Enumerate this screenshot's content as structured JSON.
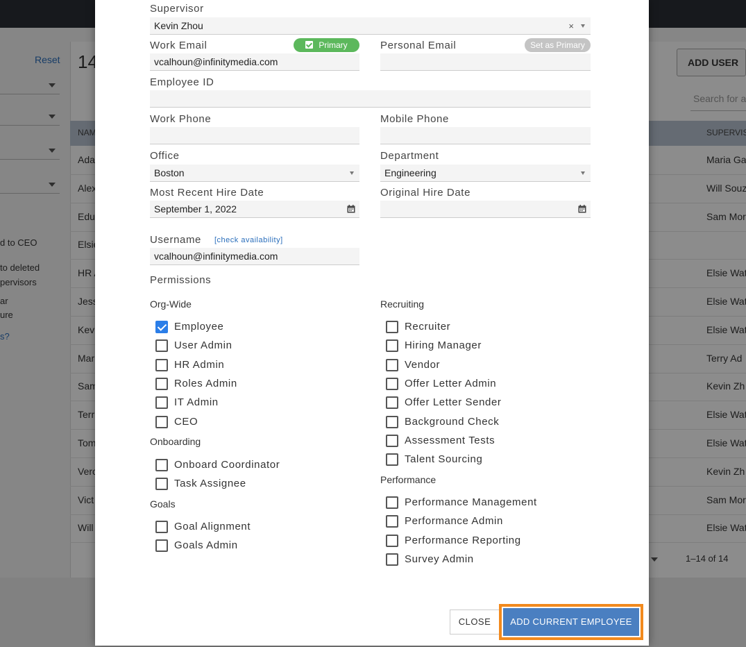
{
  "background": {
    "reset_label": "Reset",
    "count_title": "14",
    "add_user_label": "ADD USER",
    "search_placeholder": "Search for a",
    "header_name": "NAM",
    "header_supervisor": "SUPERVISO",
    "left_texts": [
      "d to CEO",
      "to deleted",
      "pervisors",
      "ar",
      "ure"
    ],
    "left_link": "s?",
    "rows": [
      {
        "name": "Ada",
        "supervisor": "Maria Ga"
      },
      {
        "name": "Alex",
        "supervisor": "Will Souz"
      },
      {
        "name": "Edu",
        "supervisor": "Sam Mor"
      },
      {
        "name": "Elsie",
        "supervisor": ""
      },
      {
        "name": "HR A",
        "supervisor": "Elsie Wat"
      },
      {
        "name": "Jess",
        "supervisor": "Elsie Wat"
      },
      {
        "name": "Kev",
        "supervisor": "Elsie Wat"
      },
      {
        "name": "Mar",
        "supervisor": "Terry Ad"
      },
      {
        "name": "Sam",
        "supervisor": "Kevin Zh"
      },
      {
        "name": "Terr",
        "supervisor": "Elsie Wat"
      },
      {
        "name": "Tom",
        "supervisor": "Elsie Wat"
      },
      {
        "name": "Vero",
        "supervisor": "Kevin Zh"
      },
      {
        "name": "Vict",
        "supervisor": "Sam Mor"
      },
      {
        "name": "Will",
        "supervisor": "Elsie Wat"
      }
    ],
    "pager_text": "1–14 of 14"
  },
  "form": {
    "supervisor_label": "Supervisor",
    "supervisor_value": "Kevin Zhou",
    "supervisor_clear": "×",
    "work_email_label": "Work Email",
    "work_email_badge": "Primary",
    "work_email_value": "vcalhoun@infinitymedia.com",
    "personal_email_label": "Personal Email",
    "personal_email_badge": "Set as Primary",
    "personal_email_value": "",
    "employee_id_label": "Employee ID",
    "employee_id_value": "",
    "work_phone_label": "Work Phone",
    "work_phone_value": "",
    "mobile_phone_label": "Mobile Phone",
    "mobile_phone_value": "",
    "office_label": "Office",
    "office_value": "Boston",
    "department_label": "Department",
    "department_value": "Engineering",
    "recent_hire_label": "Most Recent Hire Date",
    "recent_hire_value": "September 1, 2022",
    "original_hire_label": "Original Hire Date",
    "original_hire_value": "",
    "username_label": "Username",
    "check_availability": "[check availability]",
    "username_value": "vcalhoun@infinitymedia.com",
    "permissions_label": "Permissions"
  },
  "permissions": {
    "org_wide": {
      "title": "Org-Wide",
      "items": [
        {
          "label": "Employee",
          "checked": true
        },
        {
          "label": "User Admin",
          "checked": false
        },
        {
          "label": "HR Admin",
          "checked": false
        },
        {
          "label": "Roles Admin",
          "checked": false
        },
        {
          "label": "IT Admin",
          "checked": false
        },
        {
          "label": "CEO",
          "checked": false
        }
      ]
    },
    "onboarding": {
      "title": "Onboarding",
      "items": [
        {
          "label": "Onboard Coordinator",
          "checked": false
        },
        {
          "label": "Task Assignee",
          "checked": false
        }
      ]
    },
    "goals": {
      "title": "Goals",
      "items": [
        {
          "label": "Goal Alignment",
          "checked": false
        },
        {
          "label": "Goals Admin",
          "checked": false
        }
      ]
    },
    "recruiting": {
      "title": "Recruiting",
      "items": [
        {
          "label": "Recruiter",
          "checked": false
        },
        {
          "label": "Hiring Manager",
          "checked": false
        },
        {
          "label": "Vendor",
          "checked": false
        },
        {
          "label": "Offer Letter Admin",
          "checked": false
        },
        {
          "label": "Offer Letter Sender",
          "checked": false
        },
        {
          "label": "Background Check",
          "checked": false
        },
        {
          "label": "Assessment Tests",
          "checked": false
        },
        {
          "label": "Talent Sourcing",
          "checked": false
        }
      ]
    },
    "performance": {
      "title": "Performance",
      "items": [
        {
          "label": "Performance Management",
          "checked": false
        },
        {
          "label": "Performance Admin",
          "checked": false
        },
        {
          "label": "Performance Reporting",
          "checked": false
        },
        {
          "label": "Survey Admin",
          "checked": false
        }
      ]
    }
  },
  "actions": {
    "close_label": "CLOSE",
    "add_label": "ADD CURRENT EMPLOYEE"
  },
  "colors": {
    "primary_button": "#4a7fc1",
    "highlight_outline": "#f28a1e",
    "primary_badge": "#5cb85c",
    "checkbox_checked": "#2b7ee8"
  }
}
